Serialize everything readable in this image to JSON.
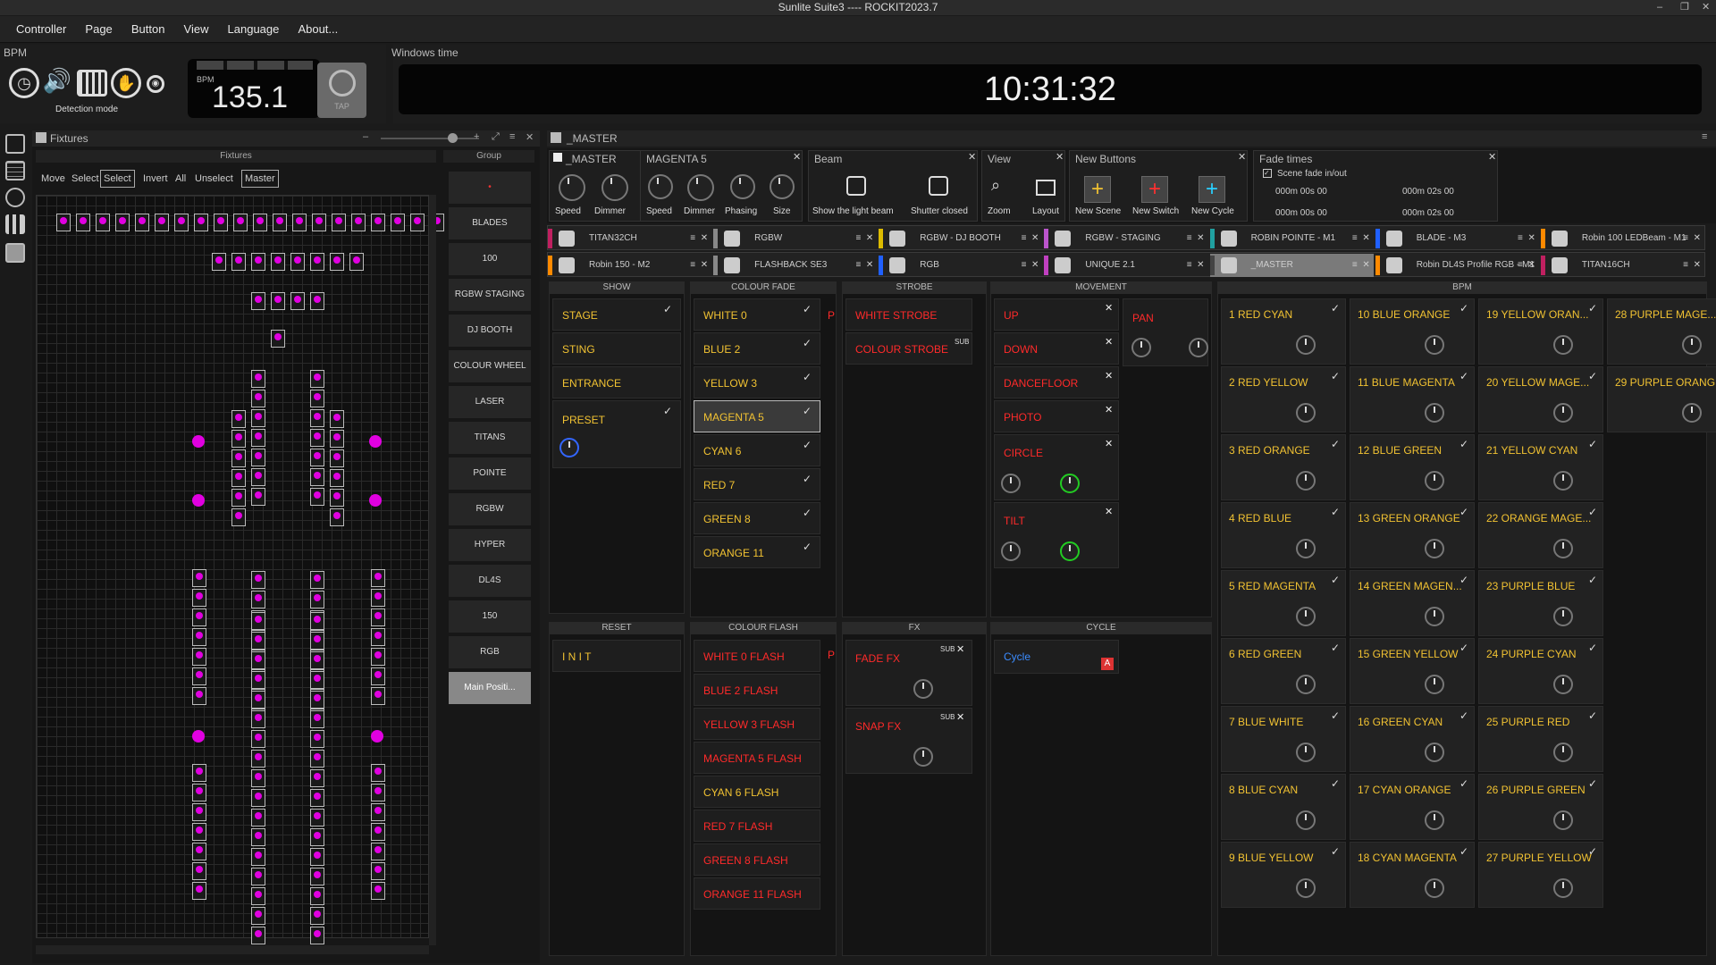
{
  "window": {
    "title": "Sunlite Suite3 ---- ROCKIT2023.7"
  },
  "menu": [
    "Controller",
    "Page",
    "Button",
    "View",
    "Language",
    "About..."
  ],
  "bpm_panel": {
    "title": "BPM",
    "detection_label": "Detection mode",
    "bpm_label": "BPM",
    "bpm_value": "135.1",
    "tap_label": "TAP"
  },
  "windows_time": {
    "title": "Windows time",
    "time": "10:31:32"
  },
  "fixtures": {
    "title": "Fixtures",
    "subtitle": "Fixtures",
    "toolbar": [
      "Move",
      "Select",
      "Select",
      "Invert",
      "All",
      "Unselect",
      "Master"
    ],
    "group_title": "Group",
    "groups": [
      "BLADES",
      "100",
      "RGBW STAGING",
      "DJ BOOTH",
      "COLOUR WHEEL",
      "LASER",
      "TITANS",
      "POINTE",
      "RGBW",
      "HYPER",
      "DL4S",
      "150",
      "RGB",
      "Main Positi..."
    ]
  },
  "master": {
    "title": "_MASTER",
    "sections": [
      {
        "title": "_MASTER",
        "knobs": [
          "Speed",
          "Dimmer"
        ]
      },
      {
        "title": "MAGENTA 5",
        "knobs": [
          "Speed",
          "Dimmer",
          "Phasing",
          "Size"
        ]
      },
      {
        "title": "Beam",
        "buttons": [
          "Show the light beam",
          "Shutter closed"
        ]
      },
      {
        "title": "View",
        "buttons": [
          "Zoom",
          "Layout"
        ]
      },
      {
        "title": "New Buttons",
        "buttons": [
          "New Scene",
          "New Switch",
          "New Cycle"
        ]
      },
      {
        "title": "Fade times",
        "checkbox": "Scene fade in/out",
        "values": [
          "000m 00s 00",
          "000m 02s 00",
          "000m 00s 00",
          "000m 02s 00"
        ]
      }
    ],
    "tabs_row1": [
      "TITAN32CH",
      "RGBW",
      "RGBW - DJ BOOTH",
      "RGBW - STAGING",
      "ROBIN POINTE - M1",
      "BLADE - M3",
      "Robin 100 LEDBeam - M1"
    ],
    "tabs_row2": [
      "Robin 150 - M2",
      "FLASHBACK SE3",
      "RGB",
      "UNIQUE 2.1",
      "_MASTER",
      "Robin DL4S Profile RGB - M1",
      "TITAN16CH"
    ],
    "columns": {
      "show": {
        "title": "SHOW",
        "items": [
          "STAGE",
          "STING",
          "ENTRANCE",
          "PRESET"
        ]
      },
      "reset": {
        "title": "RESET",
        "items": [
          "I N I T"
        ]
      },
      "colour_fade": {
        "title": "COLOUR FADE",
        "items": [
          "WHITE 0",
          "BLUE 2",
          "YELLOW 3",
          "MAGENTA 5",
          "CYAN 6",
          "RED 7",
          "GREEN 8",
          "ORANGE 11"
        ]
      },
      "colour_flash": {
        "title": "COLOUR FLASH",
        "items": [
          "WHITE 0 FLASH",
          "BLUE 2 FLASH",
          "YELLOW 3 FLASH",
          "MAGENTA 5 FLASH",
          "CYAN 6 FLASH",
          "RED 7 FLASH",
          "GREEN 8 FLASH",
          "ORANGE 11 FLASH"
        ]
      },
      "strobe": {
        "title": "STROBE",
        "items": [
          "WHITE STROBE",
          "COLOUR STROBE"
        ]
      },
      "fx": {
        "title": "FX",
        "items": [
          "FADE FX",
          "SNAP FX"
        ]
      },
      "movement": {
        "title": "MOVEMENT",
        "items": [
          "UP",
          "DOWN",
          "DANCEFLOOR",
          "PHOTO",
          "CIRCLE",
          "TILT"
        ],
        "pan": "PAN"
      },
      "cycle": {
        "title": "CYCLE",
        "items": [
          "Cycle"
        ]
      },
      "bpm": {
        "title": "BPM",
        "items": [
          "1 RED CYAN",
          "2 RED YELLOW",
          "3 RED ORANGE",
          "4 RED BLUE",
          "5 RED MAGENTA",
          "6 RED GREEN",
          "7 BLUE WHITE",
          "8 BLUE CYAN",
          "9 BLUE YELLOW",
          "10 BLUE ORANGE",
          "11 BLUE MAGENTA",
          "12 BLUE GREEN",
          "13 GREEN ORANGE",
          "14 GREEN MAGEN...",
          "15 GREEN YELLOW",
          "16 GREEN CYAN",
          "17 CYAN ORANGE",
          "18 CYAN MAGENTA",
          "19 YELLOW ORAN...",
          "20 YELLOW MAGE...",
          "21 YELLOW CYAN",
          "22 ORANGE MAGE...",
          "23 PURPLE BLUE",
          "24 PURPLE CYAN",
          "25 PURPLE RED",
          "26 PURPLE GREEN",
          "27 PURPLE YELLOW",
          "28 PURPLE MAGE...",
          "29 PURPLE ORANG"
        ]
      }
    },
    "sub_label": "SUB",
    "p_label": "P",
    "a_label": "A"
  },
  "colors": {
    "accent_yellow": "#f1c232",
    "accent_red": "#ff2a2a",
    "accent_blue": "#3b8cff",
    "fixture_magenta": "#e000e0"
  }
}
